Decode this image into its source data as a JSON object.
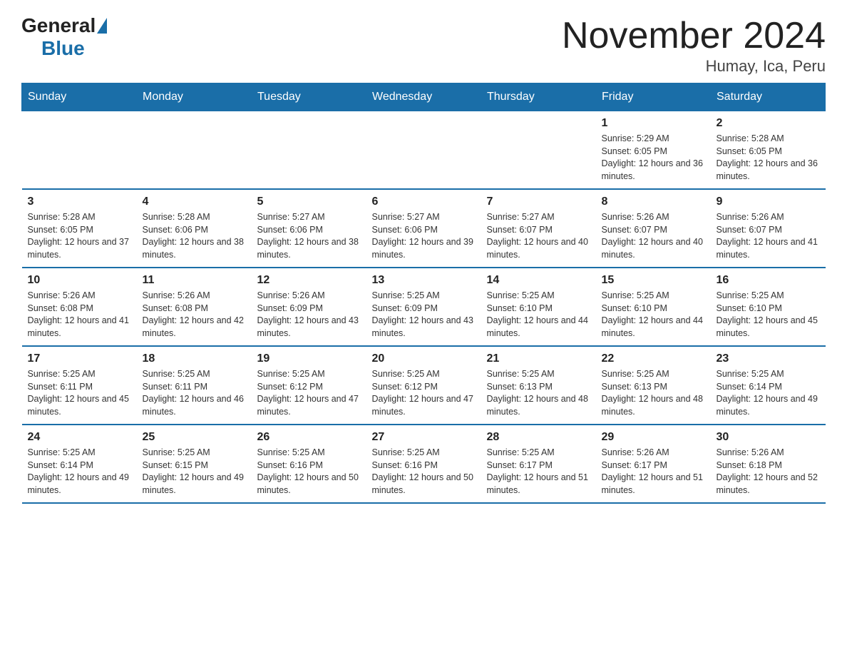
{
  "logo": {
    "general": "General",
    "blue": "Blue"
  },
  "title": "November 2024",
  "subtitle": "Humay, Ica, Peru",
  "weekdays": [
    "Sunday",
    "Monday",
    "Tuesday",
    "Wednesday",
    "Thursday",
    "Friday",
    "Saturday"
  ],
  "weeks": [
    [
      {
        "day": "",
        "info": ""
      },
      {
        "day": "",
        "info": ""
      },
      {
        "day": "",
        "info": ""
      },
      {
        "day": "",
        "info": ""
      },
      {
        "day": "",
        "info": ""
      },
      {
        "day": "1",
        "info": "Sunrise: 5:29 AM\nSunset: 6:05 PM\nDaylight: 12 hours and 36 minutes."
      },
      {
        "day": "2",
        "info": "Sunrise: 5:28 AM\nSunset: 6:05 PM\nDaylight: 12 hours and 36 minutes."
      }
    ],
    [
      {
        "day": "3",
        "info": "Sunrise: 5:28 AM\nSunset: 6:05 PM\nDaylight: 12 hours and 37 minutes."
      },
      {
        "day": "4",
        "info": "Sunrise: 5:28 AM\nSunset: 6:06 PM\nDaylight: 12 hours and 38 minutes."
      },
      {
        "day": "5",
        "info": "Sunrise: 5:27 AM\nSunset: 6:06 PM\nDaylight: 12 hours and 38 minutes."
      },
      {
        "day": "6",
        "info": "Sunrise: 5:27 AM\nSunset: 6:06 PM\nDaylight: 12 hours and 39 minutes."
      },
      {
        "day": "7",
        "info": "Sunrise: 5:27 AM\nSunset: 6:07 PM\nDaylight: 12 hours and 40 minutes."
      },
      {
        "day": "8",
        "info": "Sunrise: 5:26 AM\nSunset: 6:07 PM\nDaylight: 12 hours and 40 minutes."
      },
      {
        "day": "9",
        "info": "Sunrise: 5:26 AM\nSunset: 6:07 PM\nDaylight: 12 hours and 41 minutes."
      }
    ],
    [
      {
        "day": "10",
        "info": "Sunrise: 5:26 AM\nSunset: 6:08 PM\nDaylight: 12 hours and 41 minutes."
      },
      {
        "day": "11",
        "info": "Sunrise: 5:26 AM\nSunset: 6:08 PM\nDaylight: 12 hours and 42 minutes."
      },
      {
        "day": "12",
        "info": "Sunrise: 5:26 AM\nSunset: 6:09 PM\nDaylight: 12 hours and 43 minutes."
      },
      {
        "day": "13",
        "info": "Sunrise: 5:25 AM\nSunset: 6:09 PM\nDaylight: 12 hours and 43 minutes."
      },
      {
        "day": "14",
        "info": "Sunrise: 5:25 AM\nSunset: 6:10 PM\nDaylight: 12 hours and 44 minutes."
      },
      {
        "day": "15",
        "info": "Sunrise: 5:25 AM\nSunset: 6:10 PM\nDaylight: 12 hours and 44 minutes."
      },
      {
        "day": "16",
        "info": "Sunrise: 5:25 AM\nSunset: 6:10 PM\nDaylight: 12 hours and 45 minutes."
      }
    ],
    [
      {
        "day": "17",
        "info": "Sunrise: 5:25 AM\nSunset: 6:11 PM\nDaylight: 12 hours and 45 minutes."
      },
      {
        "day": "18",
        "info": "Sunrise: 5:25 AM\nSunset: 6:11 PM\nDaylight: 12 hours and 46 minutes."
      },
      {
        "day": "19",
        "info": "Sunrise: 5:25 AM\nSunset: 6:12 PM\nDaylight: 12 hours and 47 minutes."
      },
      {
        "day": "20",
        "info": "Sunrise: 5:25 AM\nSunset: 6:12 PM\nDaylight: 12 hours and 47 minutes."
      },
      {
        "day": "21",
        "info": "Sunrise: 5:25 AM\nSunset: 6:13 PM\nDaylight: 12 hours and 48 minutes."
      },
      {
        "day": "22",
        "info": "Sunrise: 5:25 AM\nSunset: 6:13 PM\nDaylight: 12 hours and 48 minutes."
      },
      {
        "day": "23",
        "info": "Sunrise: 5:25 AM\nSunset: 6:14 PM\nDaylight: 12 hours and 49 minutes."
      }
    ],
    [
      {
        "day": "24",
        "info": "Sunrise: 5:25 AM\nSunset: 6:14 PM\nDaylight: 12 hours and 49 minutes."
      },
      {
        "day": "25",
        "info": "Sunrise: 5:25 AM\nSunset: 6:15 PM\nDaylight: 12 hours and 49 minutes."
      },
      {
        "day": "26",
        "info": "Sunrise: 5:25 AM\nSunset: 6:16 PM\nDaylight: 12 hours and 50 minutes."
      },
      {
        "day": "27",
        "info": "Sunrise: 5:25 AM\nSunset: 6:16 PM\nDaylight: 12 hours and 50 minutes."
      },
      {
        "day": "28",
        "info": "Sunrise: 5:25 AM\nSunset: 6:17 PM\nDaylight: 12 hours and 51 minutes."
      },
      {
        "day": "29",
        "info": "Sunrise: 5:26 AM\nSunset: 6:17 PM\nDaylight: 12 hours and 51 minutes."
      },
      {
        "day": "30",
        "info": "Sunrise: 5:26 AM\nSunset: 6:18 PM\nDaylight: 12 hours and 52 minutes."
      }
    ]
  ]
}
